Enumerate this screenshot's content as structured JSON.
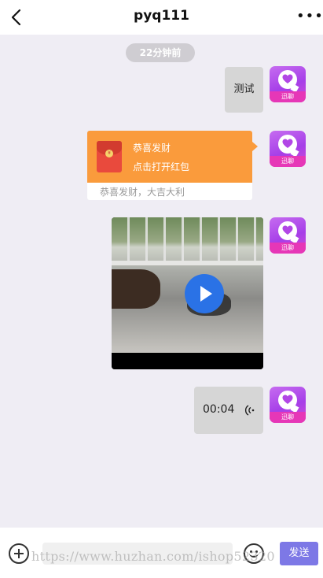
{
  "header": {
    "title": "pyq111",
    "back_icon": "chevron-left-icon",
    "more_label": "•••",
    "more_icon": "more-dots-icon"
  },
  "timestamp": "22分钟前",
  "avatar": {
    "badge_text": "迅聊",
    "icon": "heart-chat-bubble-logo"
  },
  "messages": {
    "text": "测试",
    "red_packet": {
      "title": "恭喜发财",
      "subtitle": "点击打开红包",
      "greeting": "恭喜发财，大吉大利",
      "color": "#fa9b3c"
    },
    "video": {
      "play_icon": "play-icon",
      "accent": "#2a72e6"
    },
    "voice": {
      "duration": "00:04",
      "icon": "voice-wave-icon"
    }
  },
  "composer": {
    "add_icon": "plus-circle-icon",
    "input_value": "",
    "input_placeholder": "",
    "emoji_icon": "smiley-icon",
    "send_label": "发送",
    "send_color": "#7d78e6"
  },
  "watermark": "https://www.huzhan.com/ishop52320"
}
